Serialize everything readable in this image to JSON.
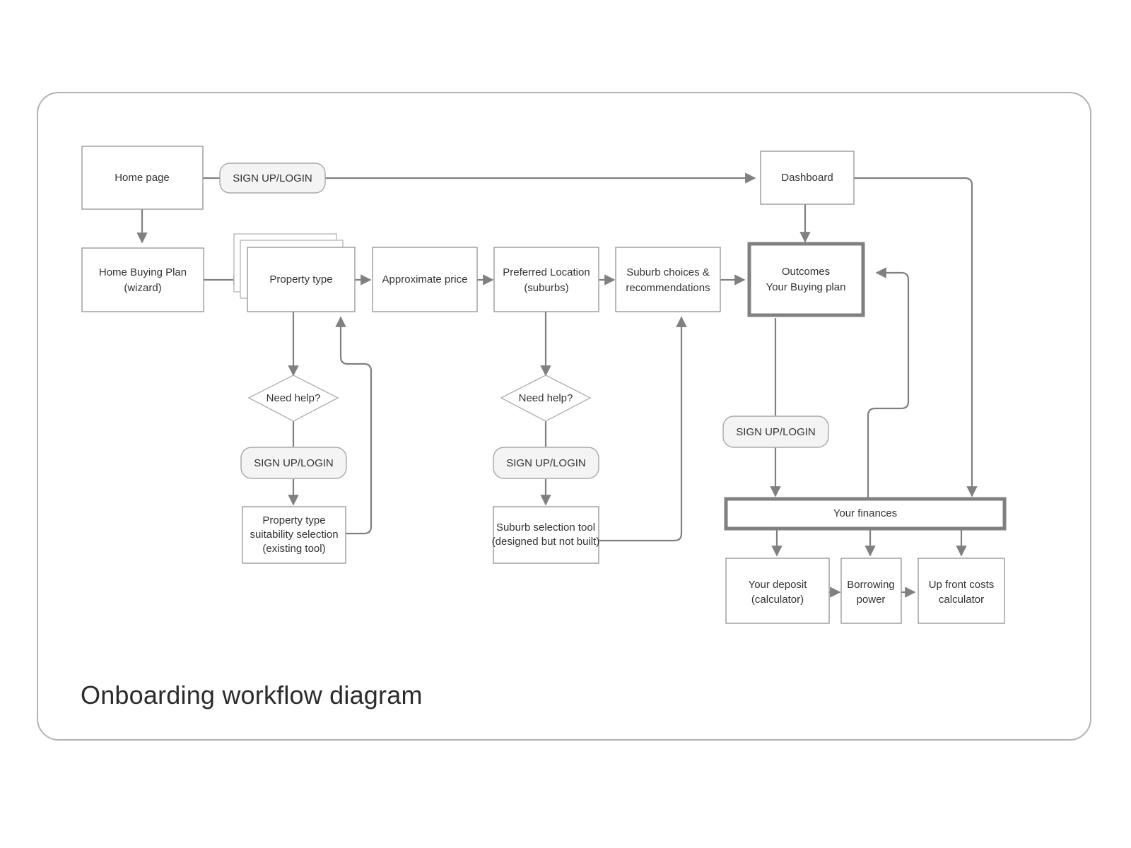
{
  "diagram": {
    "title": "Onboarding workflow diagram",
    "type": "flowchart",
    "nodes": {
      "home_page": "Home page",
      "signup_top": "SIGN UP/LOGIN",
      "dashboard": "Dashboard",
      "home_buying_plan": "Home Buying Plan\n(wizard)",
      "home_buying_plan_l1": "Home Buying Plan",
      "home_buying_plan_l2": "(wizard)",
      "property_type": "Property type",
      "approximate_price": "Approximate price",
      "preferred_location_l1": "Preferred Location",
      "preferred_location_l2": "(suburbs)",
      "suburb_choices_l1": "Suburb choices &",
      "suburb_choices_l2": "recommendations",
      "outcomes_l1": "Outcomes",
      "outcomes_l2": "Your Buying plan",
      "need_help_1": "Need help?",
      "need_help_2": "Need help?",
      "signup_left": "SIGN UP/LOGIN",
      "signup_mid": "SIGN UP/LOGIN",
      "signup_right": "SIGN UP/LOGIN",
      "property_suitability_l1": "Property type",
      "property_suitability_l2": "suitability selection",
      "property_suitability_l3": "(existing tool)",
      "suburb_tool_l1": "Suburb selection tool",
      "suburb_tool_l2": "(designed but not built)",
      "your_finances": "Your finances",
      "your_deposit_l1": "Your deposit",
      "your_deposit_l2": "(calculator)",
      "borrowing_power_l1": "Borrowing",
      "borrowing_power_l2": "power",
      "up_front_costs_l1": "Up front costs",
      "up_front_costs_l2": "calculator"
    },
    "colors": {
      "box_stroke": "#9a9a9a",
      "thick_stroke": "#808080",
      "pill_fill": "#f4f4f4",
      "edge": "#808080",
      "frame": "#b3b2ad",
      "text": "#333333",
      "title": "#2b2b2b",
      "background": "#ffffff"
    }
  }
}
